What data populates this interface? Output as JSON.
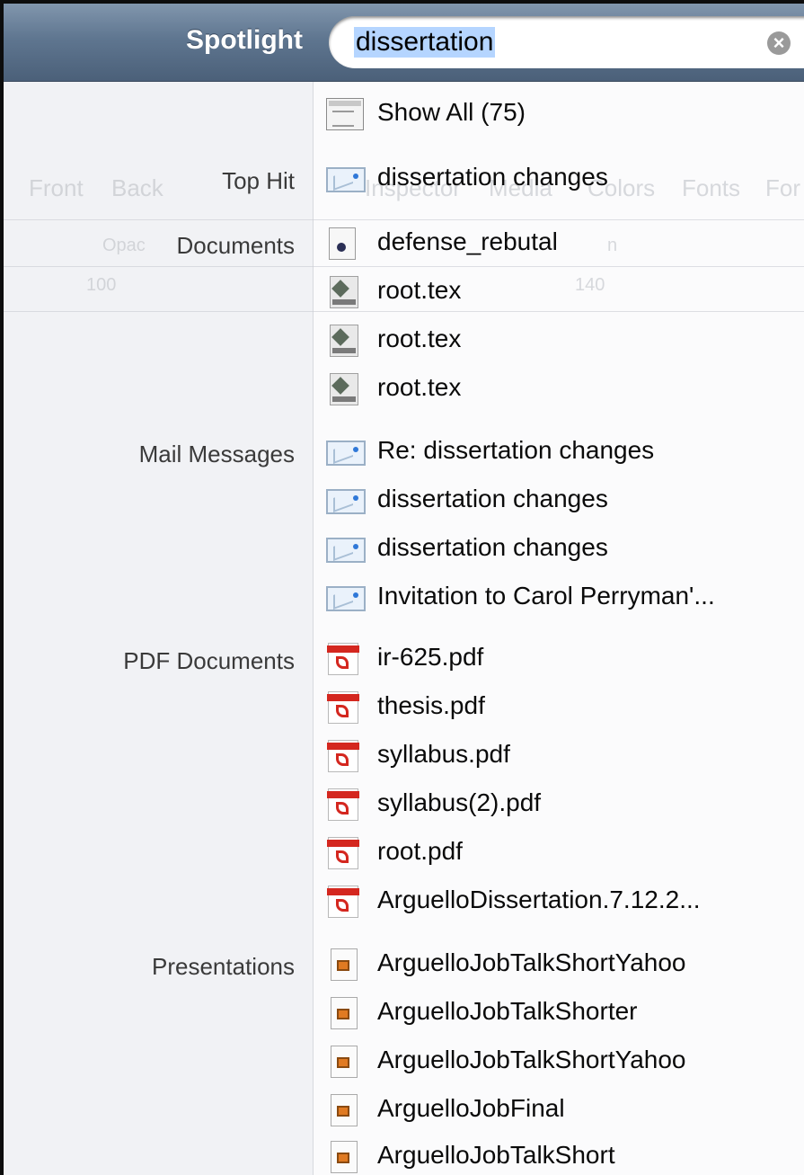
{
  "spotlight": {
    "title": "Spotlight",
    "query": "dissertation",
    "clear_icon": "clear-search-icon"
  },
  "show_all": {
    "label": "Show All (75)",
    "icon": "list-window-icon"
  },
  "categories": [
    {
      "name": "Top Hit",
      "items": [
        {
          "label": "dissertation changes",
          "icon": "mail-icon"
        }
      ]
    },
    {
      "name": "Documents",
      "items": [
        {
          "label": "defense_rebutal",
          "icon": "document-icon"
        },
        {
          "label": "root.tex",
          "icon": "tex-icon"
        },
        {
          "label": "root.tex",
          "icon": "tex-icon"
        },
        {
          "label": "root.tex",
          "icon": "tex-icon"
        }
      ]
    },
    {
      "name": "Mail Messages",
      "items": [
        {
          "label": "Re: dissertation changes",
          "icon": "mail-icon"
        },
        {
          "label": "dissertation changes",
          "icon": "mail-icon"
        },
        {
          "label": "dissertation changes",
          "icon": "mail-icon"
        },
        {
          "label": "Invitation to Carol Perryman'...",
          "icon": "mail-icon"
        }
      ]
    },
    {
      "name": "PDF Documents",
      "items": [
        {
          "label": "ir-625.pdf",
          "icon": "pdf-icon"
        },
        {
          "label": "thesis.pdf",
          "icon": "pdf-icon"
        },
        {
          "label": "syllabus.pdf",
          "icon": "pdf-icon"
        },
        {
          "label": "syllabus(2).pdf",
          "icon": "pdf-icon"
        },
        {
          "label": "root.pdf",
          "icon": "pdf-icon"
        },
        {
          "label": "ArguelloDissertation.7.12.2...",
          "icon": "pdf-icon"
        }
      ]
    },
    {
      "name": "Presentations",
      "items": [
        {
          "label": "ArguelloJobTalkShortYahoo",
          "icon": "presentation-icon"
        },
        {
          "label": "ArguelloJobTalkShorter",
          "icon": "presentation-icon"
        },
        {
          "label": "ArguelloJobTalkShortYahoo",
          "icon": "presentation-icon"
        },
        {
          "label": "ArguelloJobFinal",
          "icon": "presentation-icon"
        },
        {
          "label": "ArguelloJobTalkShort",
          "icon": "presentation-icon"
        }
      ]
    }
  ],
  "background_ghost": {
    "toolbar_labels": [
      "Front",
      "Back",
      "Inspector",
      "Media",
      "Colors",
      "Fonts",
      "For"
    ],
    "ruler_labels": [
      "100",
      "140"
    ],
    "other_labels": [
      "Opac",
      "n"
    ]
  }
}
